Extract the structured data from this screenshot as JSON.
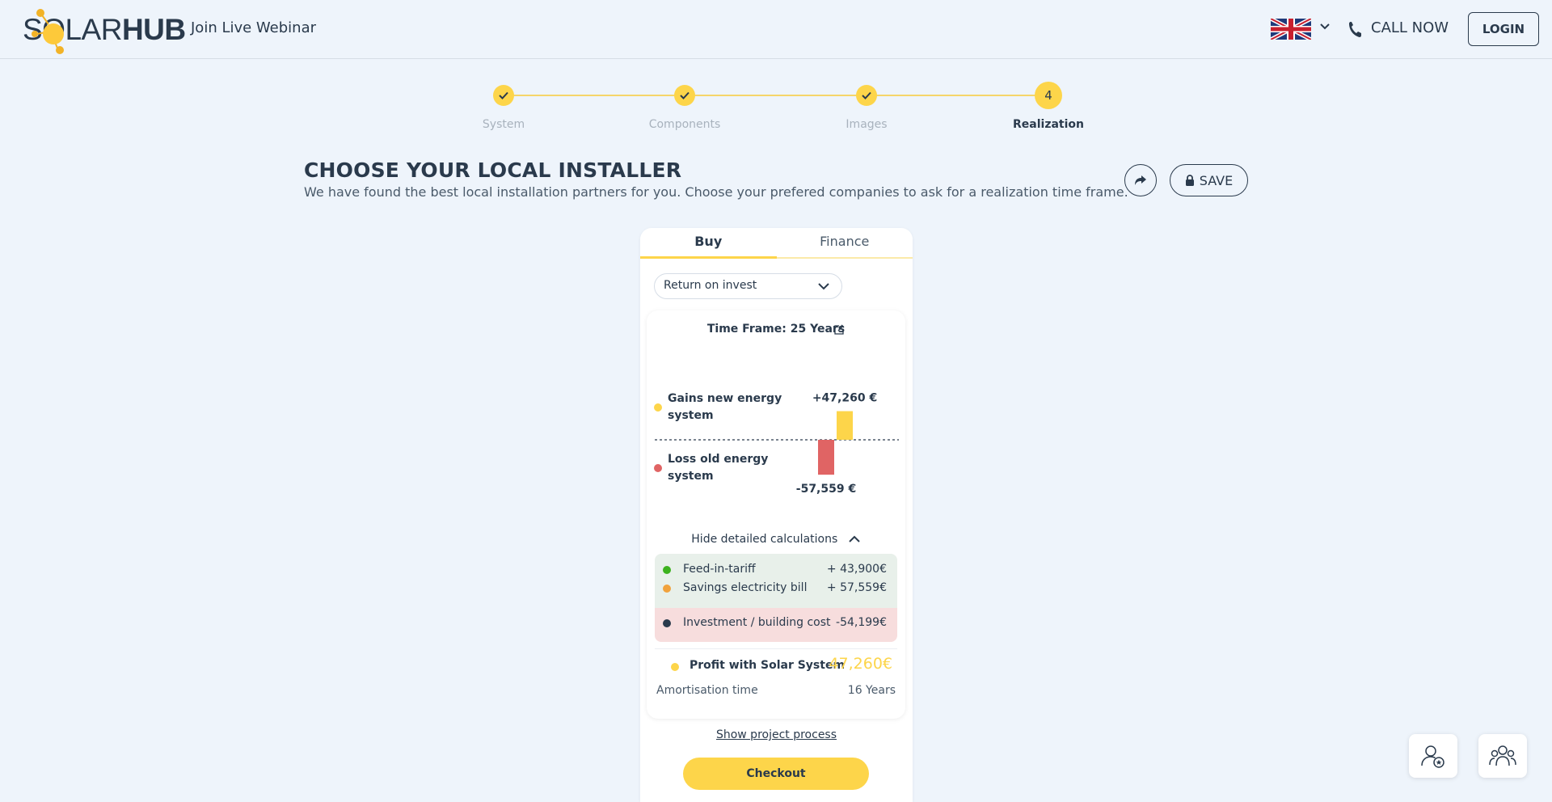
{
  "header": {
    "logo_solar": "SOLAR",
    "logo_hub": "HUB",
    "webinar_link": "Join Live Webinar",
    "language": "English (UK)",
    "call_label": "CALL NOW",
    "login_label": "LOGIN"
  },
  "stepper": {
    "steps": [
      {
        "label": "System",
        "status": "done"
      },
      {
        "label": "Components",
        "status": "done"
      },
      {
        "label": "Images",
        "status": "done"
      },
      {
        "label": "Realization",
        "status": "current",
        "number": "4"
      }
    ]
  },
  "page": {
    "title": "CHOOSE YOUR LOCAL INSTALLER",
    "subtitle": "We have found the best local installation partners for you. Choose your prefered companies to ask for a realization time frame.",
    "save_label": "SAVE"
  },
  "card": {
    "tabs": [
      {
        "label": "Buy",
        "active": true
      },
      {
        "label": "Finance",
        "active": false
      }
    ],
    "dropdown_value": "Return on invest",
    "time_frame": "Time Frame: 25 Years",
    "hide_calc": "Hide detailed calculations",
    "calc_items": [
      {
        "label": "Feed-in-tariff",
        "value": "+ 43,900€",
        "color": "#3cb21e"
      },
      {
        "label": "Savings electricity bill",
        "value": "+ 57,559€",
        "color": "#f1a23c"
      },
      {
        "label": "Investment / building cost",
        "value": "-54,199€",
        "color": "#2a3a4c"
      }
    ],
    "profit_label": "Profit with Solar System",
    "profit_value": "47,260€",
    "amort_label": "Amortisation time",
    "amort_value": "16 Years",
    "show_process": "Show project process",
    "checkout_label": "Checkout"
  },
  "chart_data": {
    "type": "bar",
    "categories": [
      "Gains new energy system",
      "Loss old energy system"
    ],
    "values": [
      47260,
      -57559
    ],
    "data_labels": [
      "+47,260 €",
      "-57,559 €"
    ],
    "colors": [
      "#fdd54a",
      "#e06464"
    ],
    "legend_label_lines": [
      [
        "Gains new energy",
        "system"
      ],
      [
        "Loss old energy",
        "system"
      ]
    ]
  },
  "colors": {
    "accent": "#fdd54a",
    "background": "#eef4fb",
    "text": "#2a3a4c"
  }
}
